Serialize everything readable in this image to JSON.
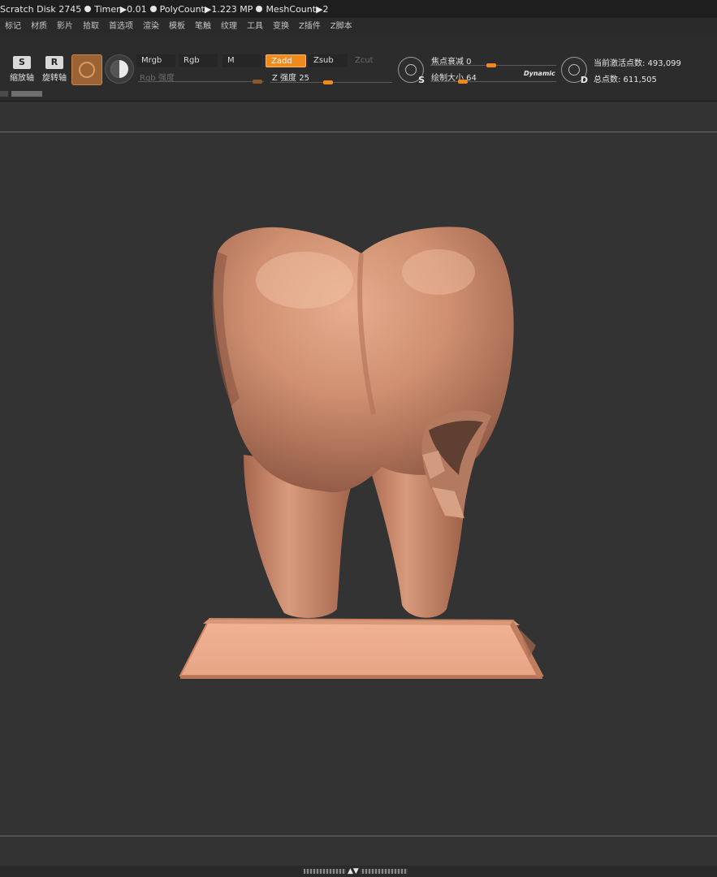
{
  "status": {
    "scratch_disk": "Scratch Disk 2745",
    "timer": "Timer▶0.01",
    "polycount": "PolyCount▶1.223 MP",
    "meshcount": "MeshCount▶2"
  },
  "menu": [
    "标记",
    "材质",
    "影片",
    "拾取",
    "首选项",
    "渲染",
    "模板",
    "笔触",
    "纹理",
    "工具",
    "变换",
    "Z插件",
    "Z脚本"
  ],
  "toolbar": {
    "scale_label": "缩放轴",
    "scale_icon": "S",
    "rotate_label": "旋转轴",
    "rotate_icon": "R",
    "mrgb": "Mrgb",
    "rgb": "Rgb",
    "m": "M",
    "zadd": "Zadd",
    "zsub": "Zsub",
    "zcut": "Zcut",
    "rgb_intensity": "Rgb 强度",
    "z_intensity": "Z 强度 25",
    "focal_shift": "焦点衰减 0",
    "draw_size": "绘制大小 64",
    "dynamic": "Dynamic",
    "brush_s": "S",
    "brush_d": "D",
    "active_points": "当前激活点数: 493,099",
    "total_points": "总点数: 611,505"
  },
  "colors": {
    "accent": "#f08a1d",
    "background": "#333333",
    "model": "#d09274"
  },
  "icons": {
    "scale": "scale-axis-icon",
    "rotate": "rotate-axis-icon",
    "material": "material-sphere-icon",
    "color": "yin-yang-color-icon",
    "brush": "brush-circle-icon"
  }
}
